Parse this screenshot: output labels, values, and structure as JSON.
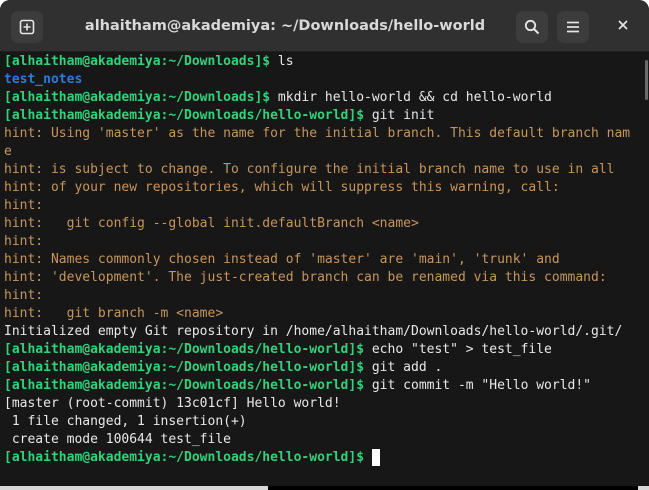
{
  "window": {
    "title": "alhaitham@akademiya: ~/Downloads/hello-world",
    "buttons": {
      "new_tab_icon": "new-tab-icon",
      "search_icon": "search-icon",
      "menu_icon": "hamburger-menu-icon",
      "close_icon": "close-icon"
    }
  },
  "colors": {
    "prompt": "#33d17a",
    "directory": "#2a7bde",
    "hint": "#c7955b",
    "text": "#e8e8e8",
    "background": "#171717",
    "titlebar": "#303030"
  },
  "terminal": {
    "prompt_downloads": "[alhaitham@akademiya:~/Downloads]$",
    "prompt_hello_world": "[alhaitham@akademiya:~/Downloads/hello-world]$",
    "lines": [
      {
        "type": "prompt",
        "prompt": "[alhaitham@akademiya:~/Downloads]$",
        "cmd": " ls"
      },
      {
        "type": "dir",
        "text": "test_notes"
      },
      {
        "type": "prompt",
        "prompt": "[alhaitham@akademiya:~/Downloads]$",
        "cmd": " mkdir hello-world && cd hello-world"
      },
      {
        "type": "prompt",
        "prompt": "[alhaitham@akademiya:~/Downloads/hello-world]$",
        "cmd": " git init"
      },
      {
        "type": "hint",
        "text": "hint: Using 'master' as the name for the initial branch. This default branch nam"
      },
      {
        "type": "hint",
        "text": "e"
      },
      {
        "type": "hint",
        "text": "hint: is subject to change. To configure the initial branch name to use in all"
      },
      {
        "type": "hint",
        "text": "hint: of your new repositories, which will suppress this warning, call:"
      },
      {
        "type": "hint",
        "text": "hint:"
      },
      {
        "type": "hint",
        "text": "hint:   git config --global init.defaultBranch <name>"
      },
      {
        "type": "hint",
        "text": "hint:"
      },
      {
        "type": "hint",
        "text": "hint: Names commonly chosen instead of 'master' are 'main', 'trunk' and"
      },
      {
        "type": "hint",
        "text": "hint: 'development'. The just-created branch can be renamed via this command:"
      },
      {
        "type": "hint",
        "text": "hint:"
      },
      {
        "type": "hint",
        "text": "hint:   git branch -m <name>"
      },
      {
        "type": "output",
        "text": "Initialized empty Git repository in /home/alhaitham/Downloads/hello-world/.git/"
      },
      {
        "type": "prompt",
        "prompt": "[alhaitham@akademiya:~/Downloads/hello-world]$",
        "cmd": " echo \"test\" > test_file"
      },
      {
        "type": "prompt",
        "prompt": "[alhaitham@akademiya:~/Downloads/hello-world]$",
        "cmd": " git add ."
      },
      {
        "type": "prompt",
        "prompt": "[alhaitham@akademiya:~/Downloads/hello-world]$",
        "cmd": " git commit -m \"Hello world!\""
      },
      {
        "type": "output",
        "text": "[master (root-commit) 13c01cf] Hello world!"
      },
      {
        "type": "output",
        "text": " 1 file changed, 1 insertion(+)"
      },
      {
        "type": "output",
        "text": " create mode 100644 test_file"
      },
      {
        "type": "active",
        "prompt": "[alhaitham@akademiya:~/Downloads/hello-world]$",
        "cmd": " "
      }
    ]
  }
}
